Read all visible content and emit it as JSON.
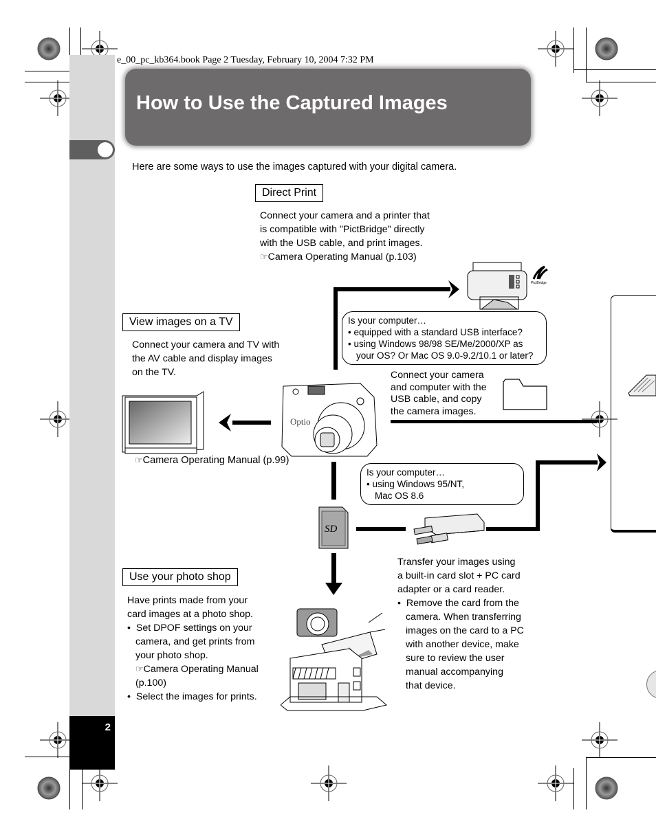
{
  "print_header": "e_00_pc_kb364.book  Page 2  Tuesday, February 10, 2004  7:32 PM",
  "page": {
    "title": "How to Use the Captured Images",
    "intro": "Here are some ways to use the images captured with your digital camera.",
    "page_number": "2"
  },
  "direct_print": {
    "label": "Direct Print",
    "lines": [
      "Connect your camera and a printer that",
      "is compatible with \"PictBridge\" directly",
      "with the USB cable, and print images."
    ],
    "ref_icon": "☞",
    "ref": "Camera Operating Manual (p.103)",
    "logo_text": "PictBridge"
  },
  "tv": {
    "label": "View images on a TV",
    "lines": [
      "Connect your camera and TV with",
      "the AV cable and display images",
      "on the TV."
    ],
    "ref_icon": "☞",
    "ref": "Camera Operating Manual (p.99)"
  },
  "usb_bubble": {
    "heading": "Is your computer…",
    "bullets": [
      "equipped with a standard USB interface?",
      "using Windows 98/98 SE/Me/2000/XP as"
    ],
    "continuation": "your OS? Or Mac OS 9.0-9.2/10.1 or later?"
  },
  "usb_copy": {
    "lines": [
      "Connect your camera",
      "and computer with the",
      "USB cable, and copy",
      "the camera images."
    ]
  },
  "card_bubble": {
    "heading": "Is your computer…",
    "bullets": [
      "using Windows 95/NT,"
    ],
    "continuation": "Mac OS 8.6"
  },
  "sd_card": {
    "label": "SD"
  },
  "card_transfer": {
    "lines": [
      "Transfer your images using",
      "a built-in card slot + PC card",
      "adapter or a card reader."
    ],
    "bullet_first": "Remove the card from the",
    "bullet_rest": [
      "camera. When transferring",
      "images on the card to a PC",
      "with another device, make",
      "sure to review the user",
      "manual accompanying",
      "that device."
    ]
  },
  "photo_shop": {
    "label": "Use your photo shop",
    "lines": [
      "Have prints made from your",
      "card images at a photo shop."
    ],
    "bullet1_first": "Set DPOF settings on your",
    "bullet1_rest": [
      "camera, and get prints from",
      "your photo shop."
    ],
    "ref_icon": "☞",
    "ref": "Camera Operating Manual",
    "ref_page": "(p.100)",
    "bullet2": "Select the images for prints."
  },
  "camera": {
    "brand": "Optio"
  },
  "bullet_char": "•"
}
